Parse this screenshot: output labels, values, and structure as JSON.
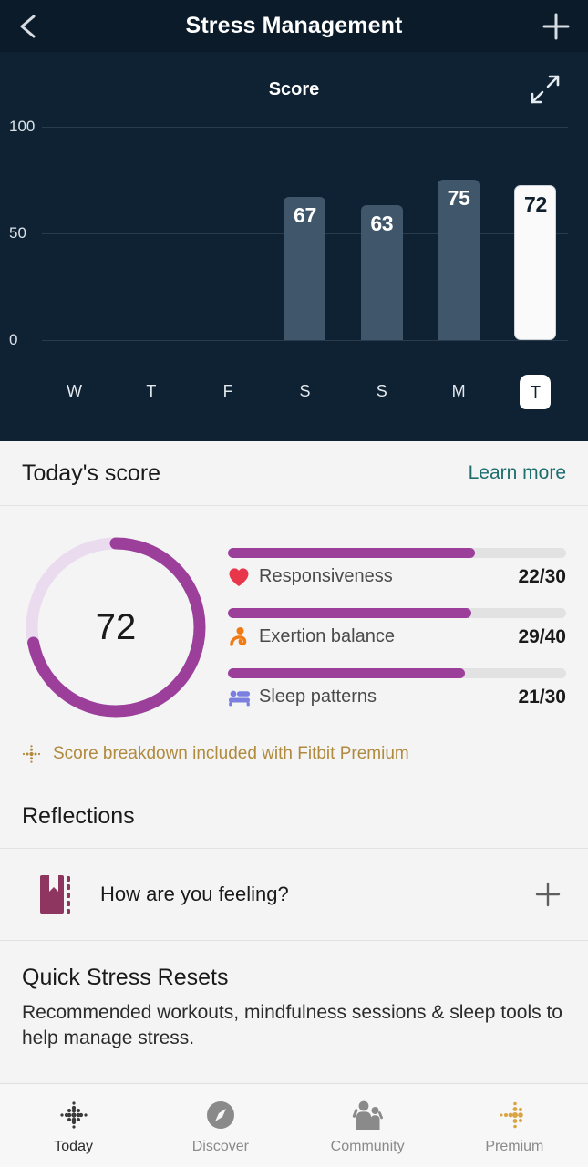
{
  "header": {
    "title": "Stress Management",
    "back_icon": "chevron-left-icon",
    "add_icon": "plus-icon"
  },
  "chart_panel": {
    "title": "Score",
    "expand_icon": "expand-diagonal-icon"
  },
  "chart_data": {
    "type": "bar",
    "title": "Score",
    "categories": [
      "W",
      "T",
      "F",
      "S",
      "S",
      "M",
      "T"
    ],
    "values": [
      null,
      null,
      null,
      67,
      63,
      75,
      72
    ],
    "labels": [
      "",
      "",
      "",
      "67",
      "63",
      "75",
      "72"
    ],
    "highlight_index": 6,
    "xlabel": "",
    "ylabel": "",
    "ylim": [
      0,
      100
    ],
    "yticks": [
      0,
      50,
      100
    ],
    "ytick_labels": [
      "0",
      "50",
      "100"
    ],
    "grid": true,
    "legend": "none",
    "bar_color": "#40566A",
    "highlight_bar_color": "#FAFAFA",
    "background": "#0E2234"
  },
  "today_score": {
    "heading": "Today's score",
    "learn_more": "Learn more",
    "gauge_value": "72",
    "gauge_percent": 72,
    "gauge_color": "#9B3F9B",
    "gauge_track_color": "#EADCEE",
    "metrics": [
      {
        "label": "Responsiveness",
        "value": "22/30",
        "percent": 73,
        "icon": "heart-icon",
        "icon_color": "#E8374A",
        "bar_color": "#9B3F9B"
      },
      {
        "label": "Exertion balance",
        "value": "29/40",
        "percent": 72,
        "icon": "person-exercise-icon",
        "icon_color": "#F07A14",
        "bar_color": "#9B3F9B"
      },
      {
        "label": "Sleep patterns",
        "value": "21/30",
        "percent": 70,
        "icon": "bed-icon",
        "icon_color": "#7B7FE0",
        "bar_color": "#9B3F9B"
      }
    ],
    "premium_note": "Score breakdown included with Fitbit Premium",
    "premium_note_color": "#B08A3E",
    "premium_icon": "fitbit-premium-dots-icon"
  },
  "reflections": {
    "heading": "Reflections",
    "item_label": "How are you feeling?",
    "item_icon": "journal-book-icon",
    "add_icon": "plus-icon"
  },
  "quick_stress_resets": {
    "title": "Quick Stress Resets",
    "description": "Recommended workouts, mindfulness sessions & sleep tools to help manage stress."
  },
  "tabbar": {
    "tabs": [
      {
        "label": "Today",
        "icon": "fitbit-dots-icon",
        "active": true
      },
      {
        "label": "Discover",
        "icon": "compass-icon",
        "active": false
      },
      {
        "label": "Community",
        "icon": "people-icon",
        "active": false
      },
      {
        "label": "Premium",
        "icon": "fitbit-premium-dots-icon",
        "active": false
      }
    ]
  }
}
